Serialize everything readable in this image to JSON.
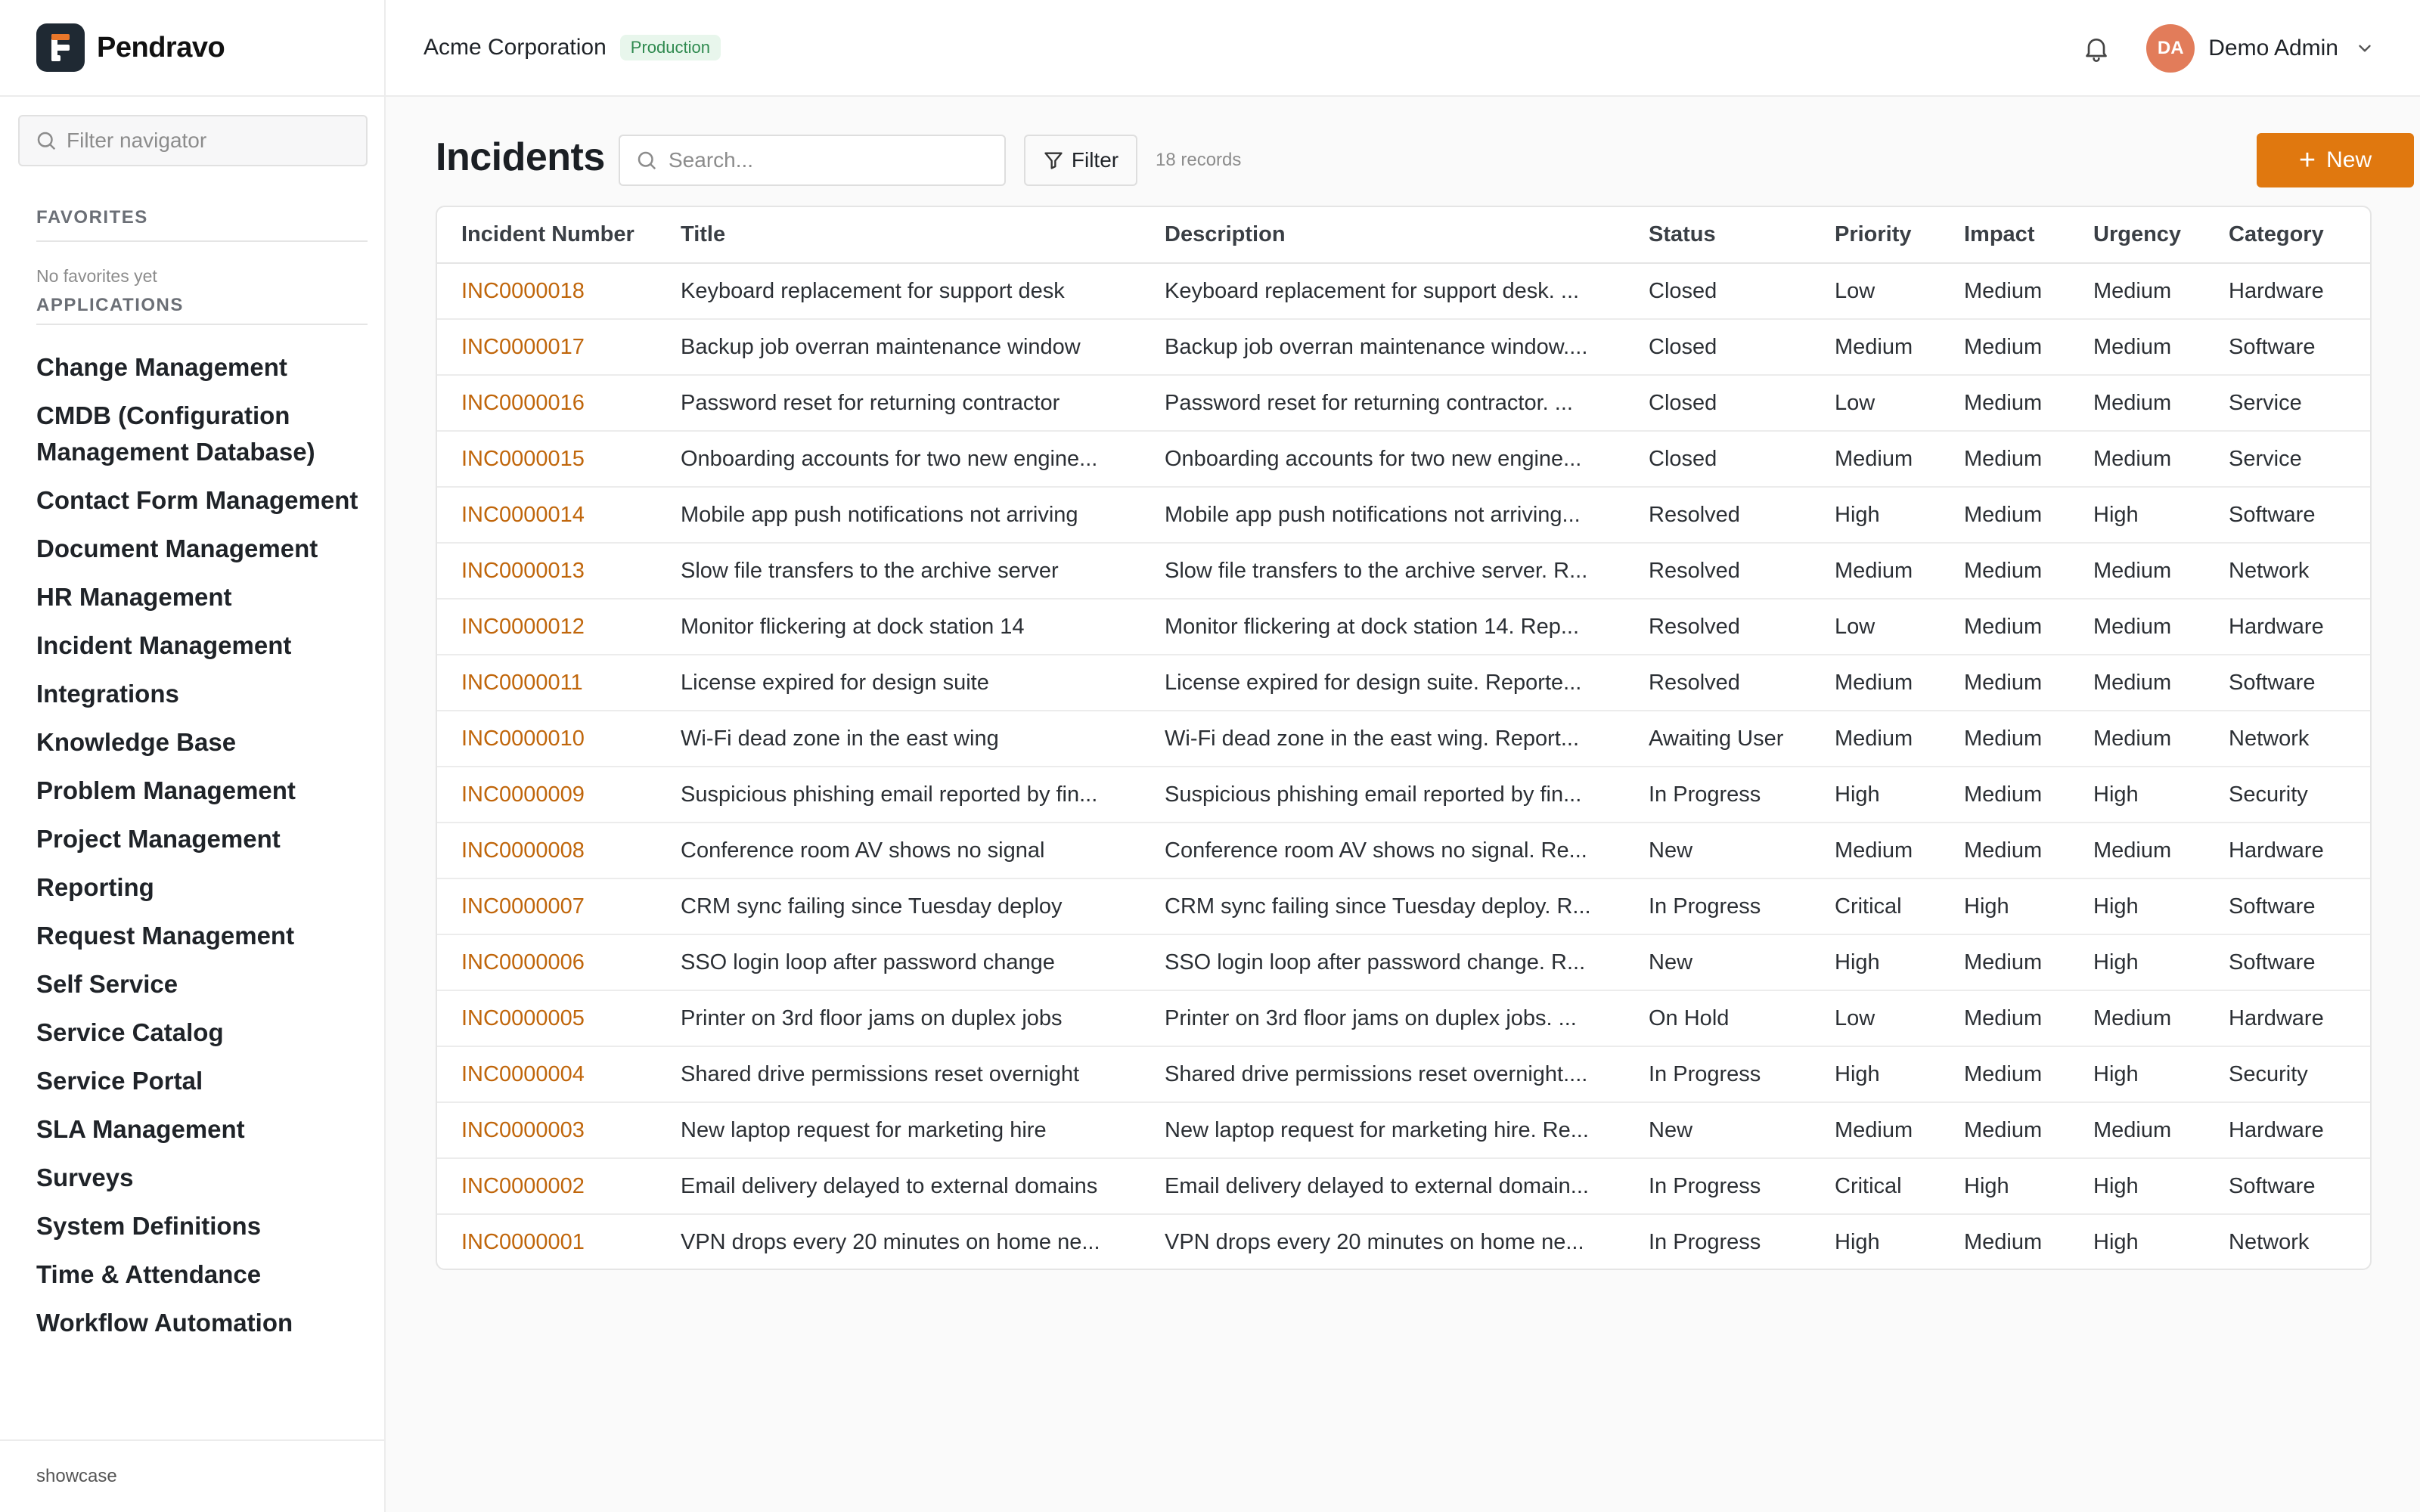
{
  "brand": {
    "name": "Pendravo"
  },
  "sidebar": {
    "filter_placeholder": "Filter navigator",
    "favorites_label": "FAVORITES",
    "favorites_empty": "No favorites yet",
    "applications_label": "APPLICATIONS",
    "apps": [
      "Change Management",
      "CMDB (Configuration Management Database)",
      "Contact Form Management",
      "Document Management",
      "HR Management",
      "Incident Management",
      "Integrations",
      "Knowledge Base",
      "Problem Management",
      "Project Management",
      "Reporting",
      "Request Management",
      "Self Service",
      "Service Catalog",
      "Service Portal",
      "SLA Management",
      "Surveys",
      "System Definitions",
      "Time & Attendance",
      "Workflow Automation"
    ],
    "footer": "showcase"
  },
  "topbar": {
    "org": "Acme Corporation",
    "env_badge": "Production",
    "avatar_initials": "DA",
    "user_name": "Demo Admin"
  },
  "main": {
    "title": "Incidents",
    "search_placeholder": "Search...",
    "filter_label": "Filter",
    "records": "18 records",
    "new_label": "New"
  },
  "table": {
    "headers": [
      "Incident Number",
      "Title",
      "Description",
      "Status",
      "Priority",
      "Impact",
      "Urgency",
      "Category"
    ],
    "rows": [
      [
        "INC0000018",
        "Keyboard replacement for support desk",
        "Keyboard replacement for support desk. ...",
        "Closed",
        "Low",
        "Medium",
        "Medium",
        "Hardware"
      ],
      [
        "INC0000017",
        "Backup job overran maintenance window",
        "Backup job overran maintenance window....",
        "Closed",
        "Medium",
        "Medium",
        "Medium",
        "Software"
      ],
      [
        "INC0000016",
        "Password reset for returning contractor",
        "Password reset for returning contractor. ...",
        "Closed",
        "Low",
        "Medium",
        "Medium",
        "Service"
      ],
      [
        "INC0000015",
        "Onboarding accounts for two new engine...",
        "Onboarding accounts for two new engine...",
        "Closed",
        "Medium",
        "Medium",
        "Medium",
        "Service"
      ],
      [
        "INC0000014",
        "Mobile app push notifications not arriving",
        "Mobile app push notifications not arriving...",
        "Resolved",
        "High",
        "Medium",
        "High",
        "Software"
      ],
      [
        "INC0000013",
        "Slow file transfers to the archive server",
        "Slow file transfers to the archive server. R...",
        "Resolved",
        "Medium",
        "Medium",
        "Medium",
        "Network"
      ],
      [
        "INC0000012",
        "Monitor flickering at dock station 14",
        "Monitor flickering at dock station 14. Rep...",
        "Resolved",
        "Low",
        "Medium",
        "Medium",
        "Hardware"
      ],
      [
        "INC0000011",
        "License expired for design suite",
        "License expired for design suite. Reporte...",
        "Resolved",
        "Medium",
        "Medium",
        "Medium",
        "Software"
      ],
      [
        "INC0000010",
        "Wi-Fi dead zone in the east wing",
        "Wi-Fi dead zone in the east wing. Report...",
        "Awaiting User",
        "Medium",
        "Medium",
        "Medium",
        "Network"
      ],
      [
        "INC0000009",
        "Suspicious phishing email reported by fin...",
        "Suspicious phishing email reported by fin...",
        "In Progress",
        "High",
        "Medium",
        "High",
        "Security"
      ],
      [
        "INC0000008",
        "Conference room AV shows no signal",
        "Conference room AV shows no signal. Re...",
        "New",
        "Medium",
        "Medium",
        "Medium",
        "Hardware"
      ],
      [
        "INC0000007",
        "CRM sync failing since Tuesday deploy",
        "CRM sync failing since Tuesday deploy. R...",
        "In Progress",
        "Critical",
        "High",
        "High",
        "Software"
      ],
      [
        "INC0000006",
        "SSO login loop after password change",
        "SSO login loop after password change. R...",
        "New",
        "High",
        "Medium",
        "High",
        "Software"
      ],
      [
        "INC0000005",
        "Printer on 3rd floor jams on duplex jobs",
        "Printer on 3rd floor jams on duplex jobs. ...",
        "On Hold",
        "Low",
        "Medium",
        "Medium",
        "Hardware"
      ],
      [
        "INC0000004",
        "Shared drive permissions reset overnight",
        "Shared drive permissions reset overnight....",
        "In Progress",
        "High",
        "Medium",
        "High",
        "Security"
      ],
      [
        "INC0000003",
        "New laptop request for marketing hire",
        "New laptop request for marketing hire. Re...",
        "New",
        "Medium",
        "Medium",
        "Medium",
        "Hardware"
      ],
      [
        "INC0000002",
        "Email delivery delayed to external domains",
        "Email delivery delayed to external domain...",
        "In Progress",
        "Critical",
        "High",
        "High",
        "Software"
      ],
      [
        "INC0000001",
        "VPN drops every 20 minutes on home ne...",
        "VPN drops every 20 minutes on home ne...",
        "In Progress",
        "High",
        "Medium",
        "High",
        "Network"
      ]
    ]
  },
  "colors": {
    "accent": "#e0780f",
    "link": "#c0660b",
    "badge_text": "#2f8a4f",
    "badge_bg": "#e8f6ec",
    "avatar": "#e27c5a"
  },
  "icons": [
    "search-icon",
    "filter-icon",
    "bell-icon",
    "chevron-down-icon",
    "plus-icon"
  ]
}
